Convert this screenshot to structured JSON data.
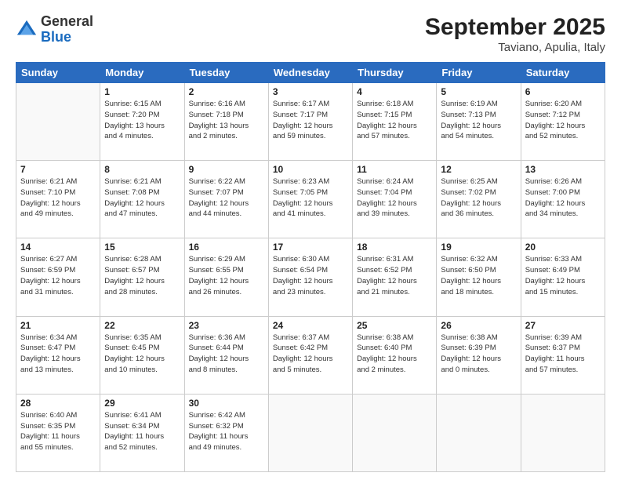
{
  "header": {
    "logo_general": "General",
    "logo_blue": "Blue",
    "month": "September 2025",
    "location": "Taviano, Apulia, Italy"
  },
  "days_of_week": [
    "Sunday",
    "Monday",
    "Tuesday",
    "Wednesday",
    "Thursday",
    "Friday",
    "Saturday"
  ],
  "weeks": [
    [
      {
        "num": "",
        "info": ""
      },
      {
        "num": "1",
        "info": "Sunrise: 6:15 AM\nSunset: 7:20 PM\nDaylight: 13 hours\nand 4 minutes."
      },
      {
        "num": "2",
        "info": "Sunrise: 6:16 AM\nSunset: 7:18 PM\nDaylight: 13 hours\nand 2 minutes."
      },
      {
        "num": "3",
        "info": "Sunrise: 6:17 AM\nSunset: 7:17 PM\nDaylight: 12 hours\nand 59 minutes."
      },
      {
        "num": "4",
        "info": "Sunrise: 6:18 AM\nSunset: 7:15 PM\nDaylight: 12 hours\nand 57 minutes."
      },
      {
        "num": "5",
        "info": "Sunrise: 6:19 AM\nSunset: 7:13 PM\nDaylight: 12 hours\nand 54 minutes."
      },
      {
        "num": "6",
        "info": "Sunrise: 6:20 AM\nSunset: 7:12 PM\nDaylight: 12 hours\nand 52 minutes."
      }
    ],
    [
      {
        "num": "7",
        "info": "Sunrise: 6:21 AM\nSunset: 7:10 PM\nDaylight: 12 hours\nand 49 minutes."
      },
      {
        "num": "8",
        "info": "Sunrise: 6:21 AM\nSunset: 7:08 PM\nDaylight: 12 hours\nand 47 minutes."
      },
      {
        "num": "9",
        "info": "Sunrise: 6:22 AM\nSunset: 7:07 PM\nDaylight: 12 hours\nand 44 minutes."
      },
      {
        "num": "10",
        "info": "Sunrise: 6:23 AM\nSunset: 7:05 PM\nDaylight: 12 hours\nand 41 minutes."
      },
      {
        "num": "11",
        "info": "Sunrise: 6:24 AM\nSunset: 7:04 PM\nDaylight: 12 hours\nand 39 minutes."
      },
      {
        "num": "12",
        "info": "Sunrise: 6:25 AM\nSunset: 7:02 PM\nDaylight: 12 hours\nand 36 minutes."
      },
      {
        "num": "13",
        "info": "Sunrise: 6:26 AM\nSunset: 7:00 PM\nDaylight: 12 hours\nand 34 minutes."
      }
    ],
    [
      {
        "num": "14",
        "info": "Sunrise: 6:27 AM\nSunset: 6:59 PM\nDaylight: 12 hours\nand 31 minutes."
      },
      {
        "num": "15",
        "info": "Sunrise: 6:28 AM\nSunset: 6:57 PM\nDaylight: 12 hours\nand 28 minutes."
      },
      {
        "num": "16",
        "info": "Sunrise: 6:29 AM\nSunset: 6:55 PM\nDaylight: 12 hours\nand 26 minutes."
      },
      {
        "num": "17",
        "info": "Sunrise: 6:30 AM\nSunset: 6:54 PM\nDaylight: 12 hours\nand 23 minutes."
      },
      {
        "num": "18",
        "info": "Sunrise: 6:31 AM\nSunset: 6:52 PM\nDaylight: 12 hours\nand 21 minutes."
      },
      {
        "num": "19",
        "info": "Sunrise: 6:32 AM\nSunset: 6:50 PM\nDaylight: 12 hours\nand 18 minutes."
      },
      {
        "num": "20",
        "info": "Sunrise: 6:33 AM\nSunset: 6:49 PM\nDaylight: 12 hours\nand 15 minutes."
      }
    ],
    [
      {
        "num": "21",
        "info": "Sunrise: 6:34 AM\nSunset: 6:47 PM\nDaylight: 12 hours\nand 13 minutes."
      },
      {
        "num": "22",
        "info": "Sunrise: 6:35 AM\nSunset: 6:45 PM\nDaylight: 12 hours\nand 10 minutes."
      },
      {
        "num": "23",
        "info": "Sunrise: 6:36 AM\nSunset: 6:44 PM\nDaylight: 12 hours\nand 8 minutes."
      },
      {
        "num": "24",
        "info": "Sunrise: 6:37 AM\nSunset: 6:42 PM\nDaylight: 12 hours\nand 5 minutes."
      },
      {
        "num": "25",
        "info": "Sunrise: 6:38 AM\nSunset: 6:40 PM\nDaylight: 12 hours\nand 2 minutes."
      },
      {
        "num": "26",
        "info": "Sunrise: 6:38 AM\nSunset: 6:39 PM\nDaylight: 12 hours\nand 0 minutes."
      },
      {
        "num": "27",
        "info": "Sunrise: 6:39 AM\nSunset: 6:37 PM\nDaylight: 11 hours\nand 57 minutes."
      }
    ],
    [
      {
        "num": "28",
        "info": "Sunrise: 6:40 AM\nSunset: 6:35 PM\nDaylight: 11 hours\nand 55 minutes."
      },
      {
        "num": "29",
        "info": "Sunrise: 6:41 AM\nSunset: 6:34 PM\nDaylight: 11 hours\nand 52 minutes."
      },
      {
        "num": "30",
        "info": "Sunrise: 6:42 AM\nSunset: 6:32 PM\nDaylight: 11 hours\nand 49 minutes."
      },
      {
        "num": "",
        "info": ""
      },
      {
        "num": "",
        "info": ""
      },
      {
        "num": "",
        "info": ""
      },
      {
        "num": "",
        "info": ""
      }
    ]
  ]
}
